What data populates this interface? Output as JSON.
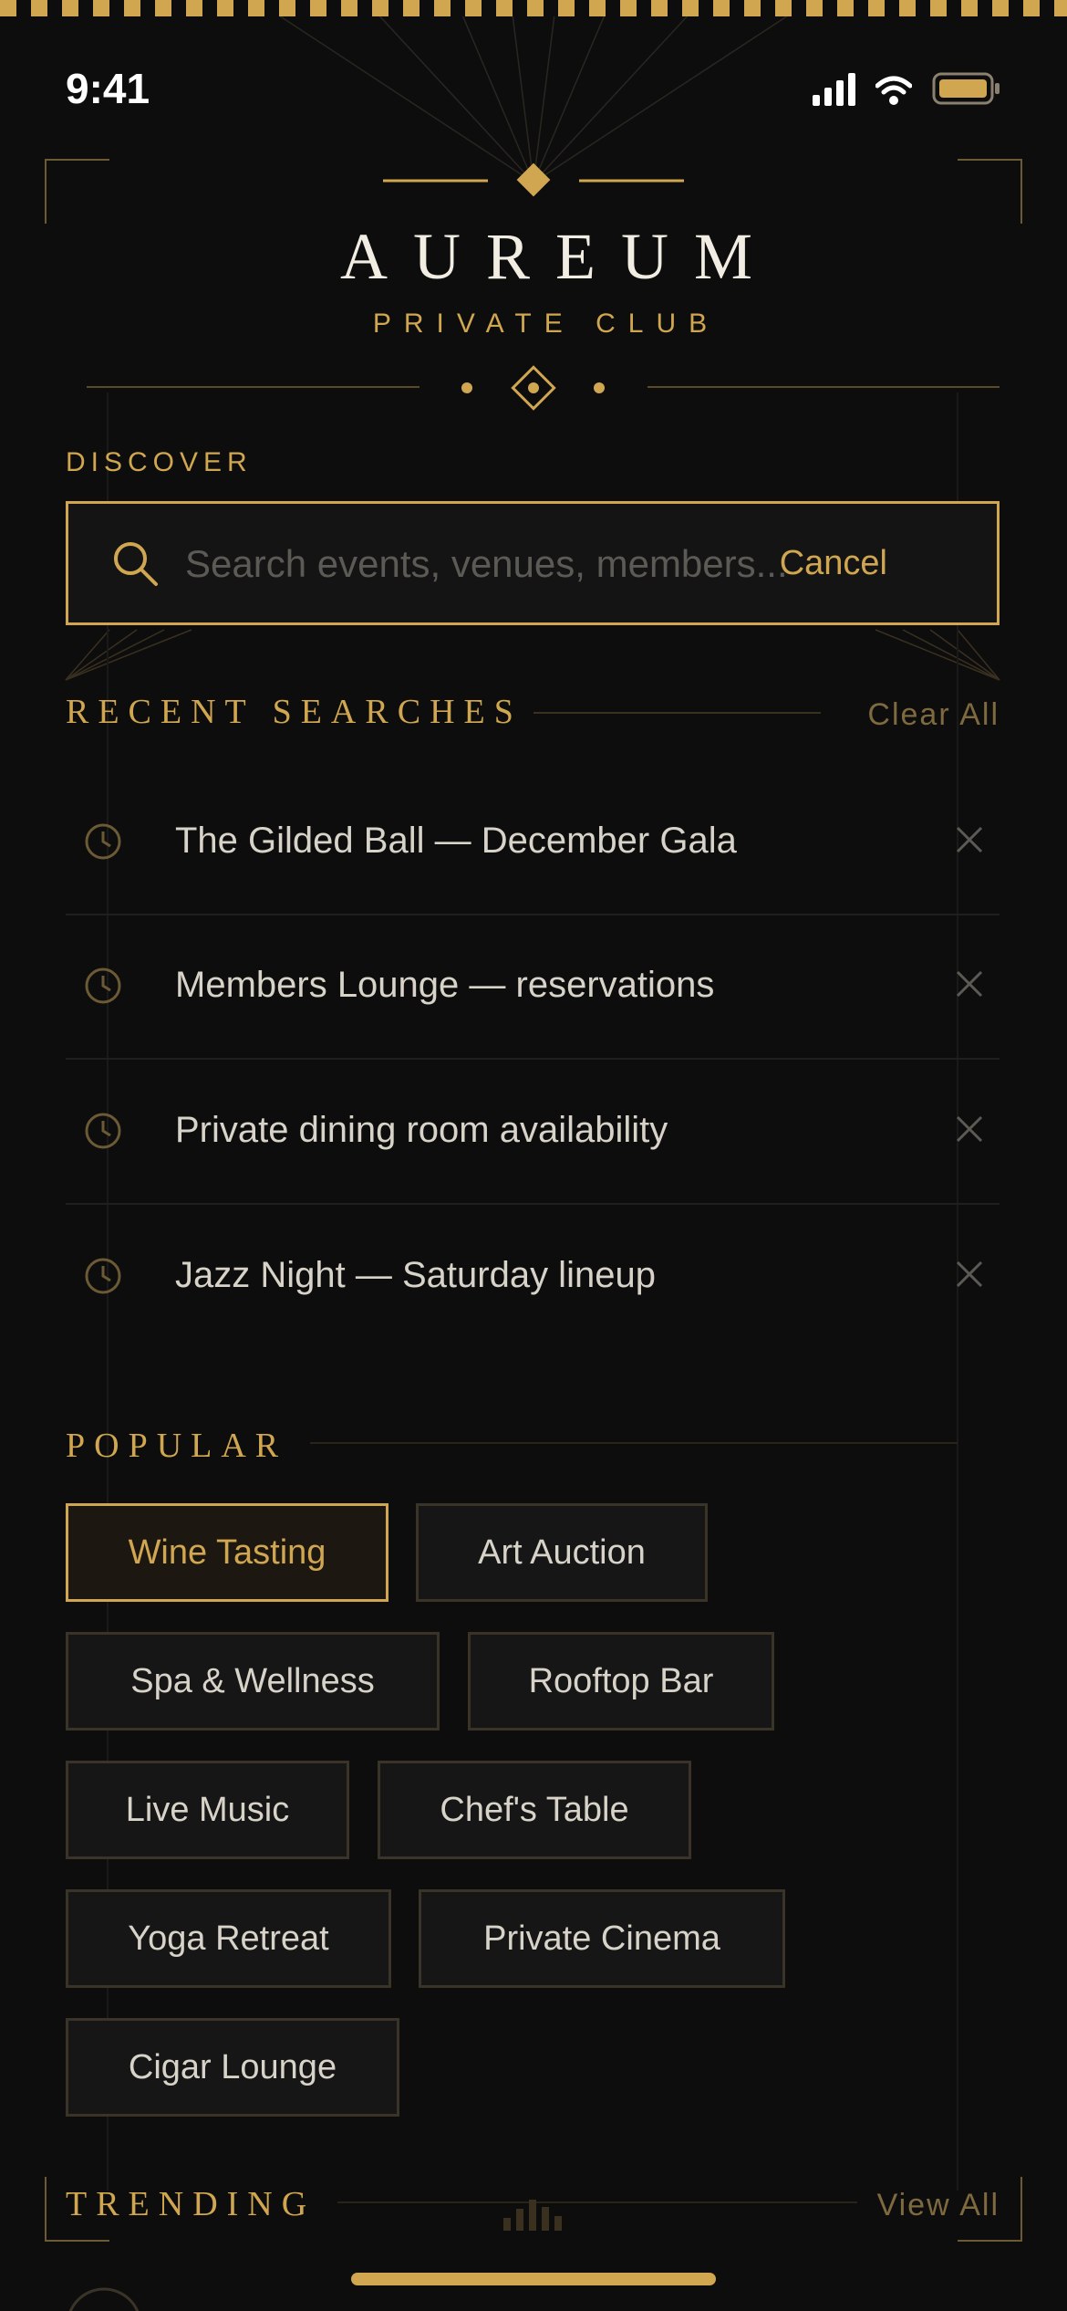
{
  "status": {
    "time": "9:41"
  },
  "brand": {
    "title": "AUREUM",
    "subtitle": "PRIVATE CLUB"
  },
  "search": {
    "section_label": "DISCOVER",
    "placeholder": "Search events, venues, members...",
    "cancel_label": "Cancel"
  },
  "recent": {
    "title": "RECENT SEARCHES",
    "clear_label": "Clear All",
    "items": [
      {
        "label": "The Gilded Ball — December Gala"
      },
      {
        "label": "Members Lounge — reservations"
      },
      {
        "label": "Private dining room availability"
      },
      {
        "label": "Jazz Night — Saturday lineup"
      }
    ]
  },
  "popular": {
    "title": "POPULAR",
    "chips": [
      {
        "label": "Wine Tasting",
        "active": true
      },
      {
        "label": "Art Auction"
      },
      {
        "label": "Spa & Wellness"
      },
      {
        "label": "Rooftop Bar"
      },
      {
        "label": "Live Music"
      },
      {
        "label": "Chef's Table"
      },
      {
        "label": "Yoga Retreat"
      },
      {
        "label": "Private Cinema"
      },
      {
        "label": "Cigar Lounge"
      }
    ]
  },
  "trending": {
    "title": "TRENDING",
    "view_all_label": "View All"
  },
  "colors": {
    "accent": "#d0a650",
    "background": "#0d0d0d",
    "text": "#d8d3c8"
  }
}
